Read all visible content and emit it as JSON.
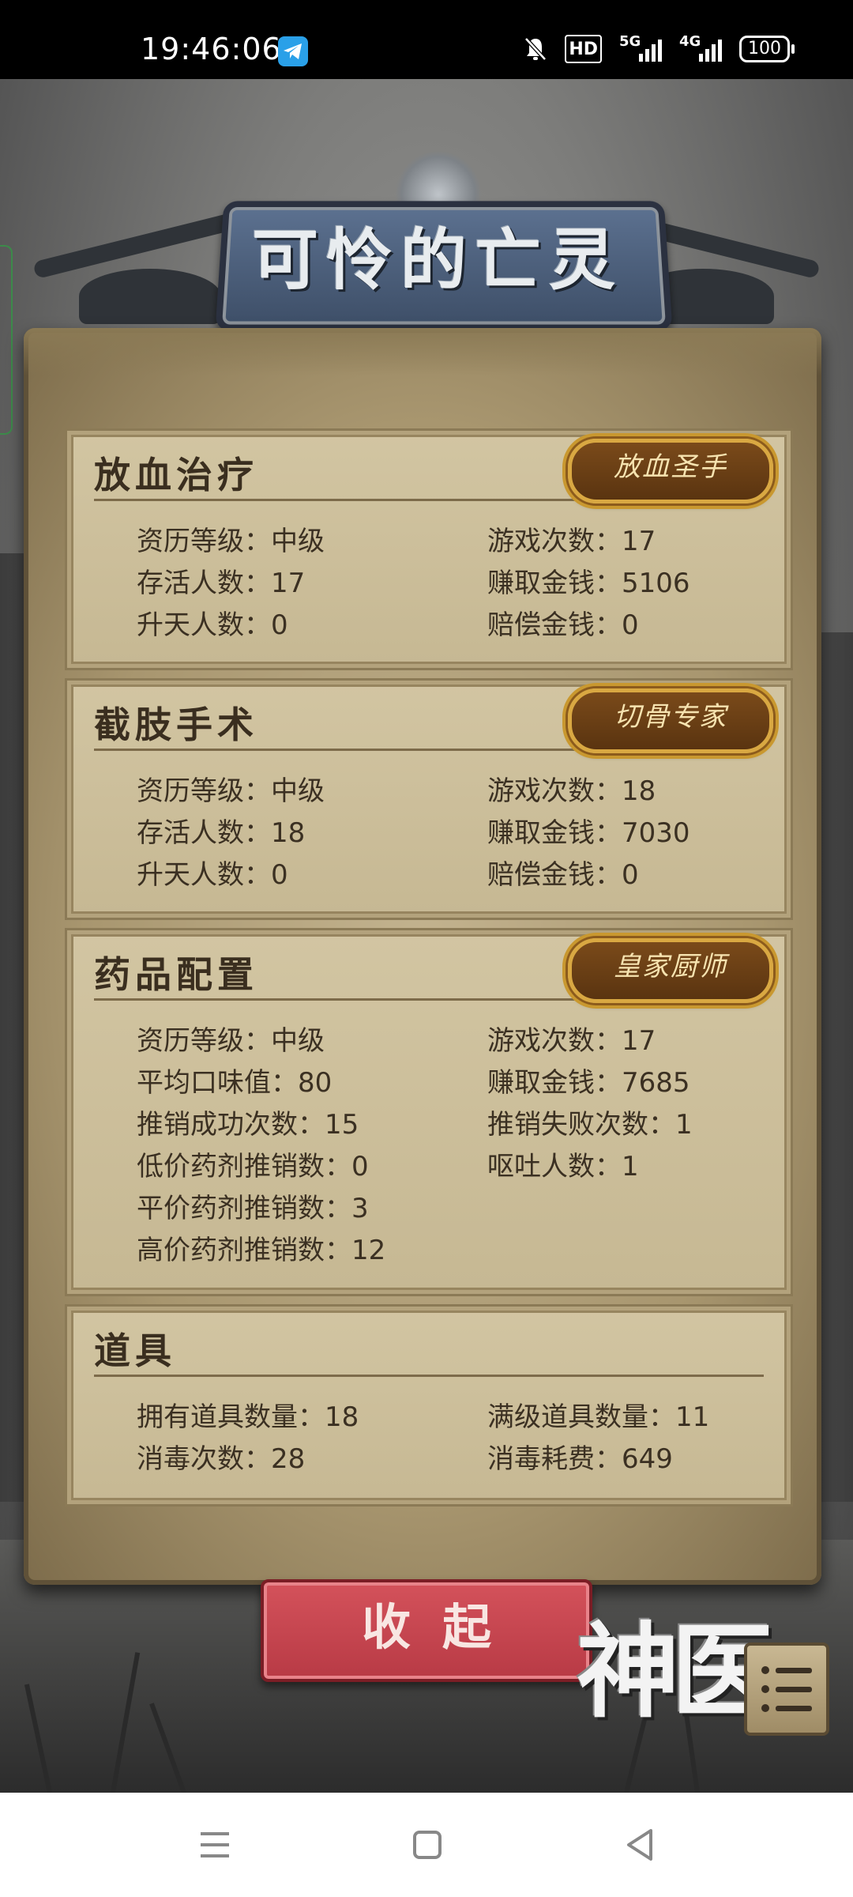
{
  "status_bar": {
    "time": "19:46:06",
    "hd_label": "HD",
    "net1": "5G",
    "net2": "4G",
    "battery": "100",
    "icons": [
      "telegram-icon",
      "mute-bell-icon",
      "hd-icon",
      "signal-5g-icon",
      "signal-4g-icon",
      "battery-icon"
    ]
  },
  "header": {
    "title": "可怜的亡灵"
  },
  "sections": {
    "bloodletting": {
      "title": "放血治疗",
      "badge": "放血圣手",
      "level": "资历等级：中级",
      "plays": "游戏次数：17",
      "survivors": "存活人数：17",
      "earned": "赚取金钱：5106",
      "ascended": "升天人数：0",
      "compensation": "赔偿金钱：0"
    },
    "amputation": {
      "title": "截肢手术",
      "badge": "切骨专家",
      "level": "资历等级：中级",
      "plays": "游戏次数：18",
      "survivors": "存活人数：18",
      "earned": "赚取金钱：7030",
      "ascended": "升天人数：0",
      "compensation": "赔偿金钱：0"
    },
    "medicine": {
      "title": "药品配置",
      "badge": "皇家厨师",
      "level": "资历等级：中级",
      "plays": "游戏次数：17",
      "avg_taste": "平均口味值：80",
      "earned": "赚取金钱：7685",
      "sell_success": "推销成功次数：15",
      "sell_fail": "推销失败次数：1",
      "low_price": "低价药剂推销数：0",
      "vomit": "呕吐人数：1",
      "mid_price": "平价药剂推销数：3",
      "high_price": "高价药剂推销数：12"
    },
    "items": {
      "title": "道具",
      "owned": "拥有道具数量：18",
      "max_level": "满级道具数量：11",
      "disinfect_count": "消毒次数：28",
      "disinfect_cost": "消毒耗费：649"
    }
  },
  "footer": {
    "collapse_label": "收起",
    "logo_text": "神医"
  },
  "nav": {
    "icons": [
      "menu-lines-icon",
      "home-square-icon",
      "back-triangle-icon"
    ]
  }
}
